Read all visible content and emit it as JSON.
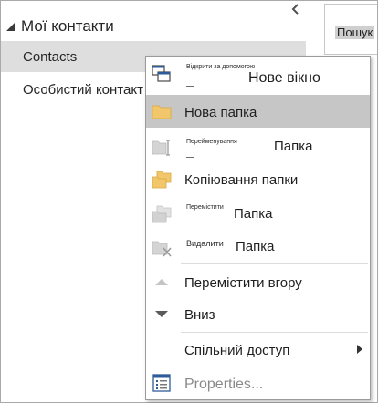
{
  "folder_pane": {
    "group_title": "Мої контакти",
    "items": [
      {
        "label": "Contacts"
      },
      {
        "label": "Особистий контакт"
      }
    ]
  },
  "search": {
    "text": "Пошук"
  },
  "context_menu": {
    "open_new_window": {
      "small": "Відкрити за допомогою",
      "label": "Нове вікно"
    },
    "new_folder": {
      "label": "Нова папка"
    },
    "rename_folder": {
      "small": "Перейменування",
      "label": "Папка"
    },
    "copy_folder": {
      "label": "Копіювання папки"
    },
    "move_folder": {
      "small": "Перемістити",
      "label": "Папка"
    },
    "delete_folder": {
      "small": "Видалити",
      "label": "Папка"
    },
    "move_up": {
      "label": "Перемістити вгору"
    },
    "move_down": {
      "label": "Вниз"
    },
    "sharing": {
      "label": "Спільний доступ"
    },
    "properties": {
      "label": "Properties..."
    }
  },
  "colors": {
    "folder_yellow": "#f2c76b",
    "highlight": "#c6c6c6",
    "selected_item": "#dedede",
    "disabled_icon": "#b9b9b9",
    "accent_blue": "#2e5c99"
  }
}
